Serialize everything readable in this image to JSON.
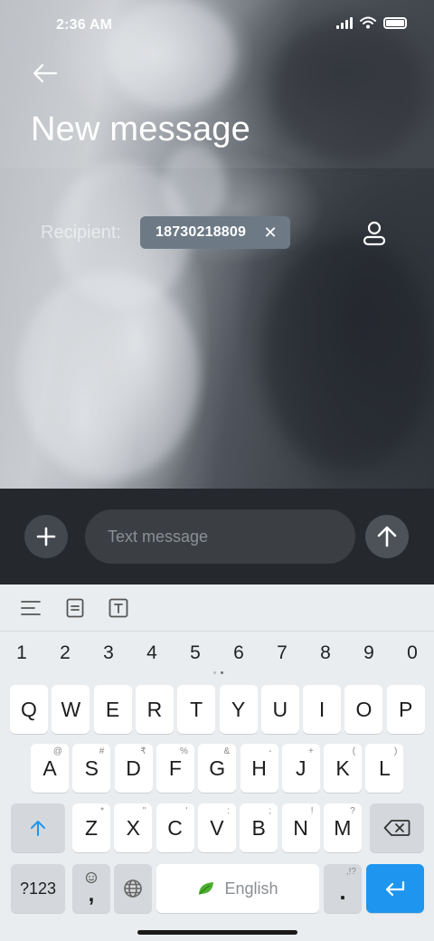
{
  "status_bar": {
    "time": "2:36 AM"
  },
  "header": {
    "title": "New message"
  },
  "recipient": {
    "label": "Recipient:",
    "number": "18730218809"
  },
  "compose": {
    "placeholder": "Text message"
  },
  "keyboard": {
    "number_row": [
      "1",
      "2",
      "3",
      "4",
      "5",
      "6",
      "7",
      "8",
      "9",
      "0"
    ],
    "row1": [
      {
        "k": "Q"
      },
      {
        "k": "W"
      },
      {
        "k": "E"
      },
      {
        "k": "R"
      },
      {
        "k": "T"
      },
      {
        "k": "Y"
      },
      {
        "k": "U"
      },
      {
        "k": "I"
      },
      {
        "k": "O"
      },
      {
        "k": "P"
      }
    ],
    "row2": [
      {
        "k": "A",
        "h": "@"
      },
      {
        "k": "S",
        "h": "#"
      },
      {
        "k": "D",
        "h": "₹"
      },
      {
        "k": "F",
        "h": "%"
      },
      {
        "k": "G",
        "h": "&"
      },
      {
        "k": "H",
        "h": "-"
      },
      {
        "k": "J",
        "h": "+"
      },
      {
        "k": "K",
        "h": "("
      },
      {
        "k": "L",
        "h": ")"
      }
    ],
    "row3": [
      {
        "k": "Z",
        "h": "*"
      },
      {
        "k": "X",
        "h": "\""
      },
      {
        "k": "C",
        "h": "'"
      },
      {
        "k": "V",
        "h": ":"
      },
      {
        "k": "B",
        "h": ";"
      },
      {
        "k": "N",
        "h": "!"
      },
      {
        "k": "M",
        "h": "?"
      }
    ],
    "symbols_label": "?123",
    "comma_label": ",",
    "space_label": "English",
    "period_label": ".",
    "period_hint": ",!?"
  },
  "colors": {
    "enter_key": "#1e96f0",
    "compose_bar": "#25282c",
    "chip": "#6d7a86"
  },
  "icons": [
    "back-arrow-icon",
    "signal-icon",
    "wifi-icon",
    "battery-icon",
    "remove-recipient-icon",
    "contact-icon",
    "plus-icon",
    "send-arrow-icon",
    "menu-lines-icon",
    "clipboard-icon",
    "text-format-icon",
    "shift-icon",
    "backspace-icon",
    "emoji-icon",
    "globe-icon",
    "leaf-icon",
    "enter-icon"
  ]
}
